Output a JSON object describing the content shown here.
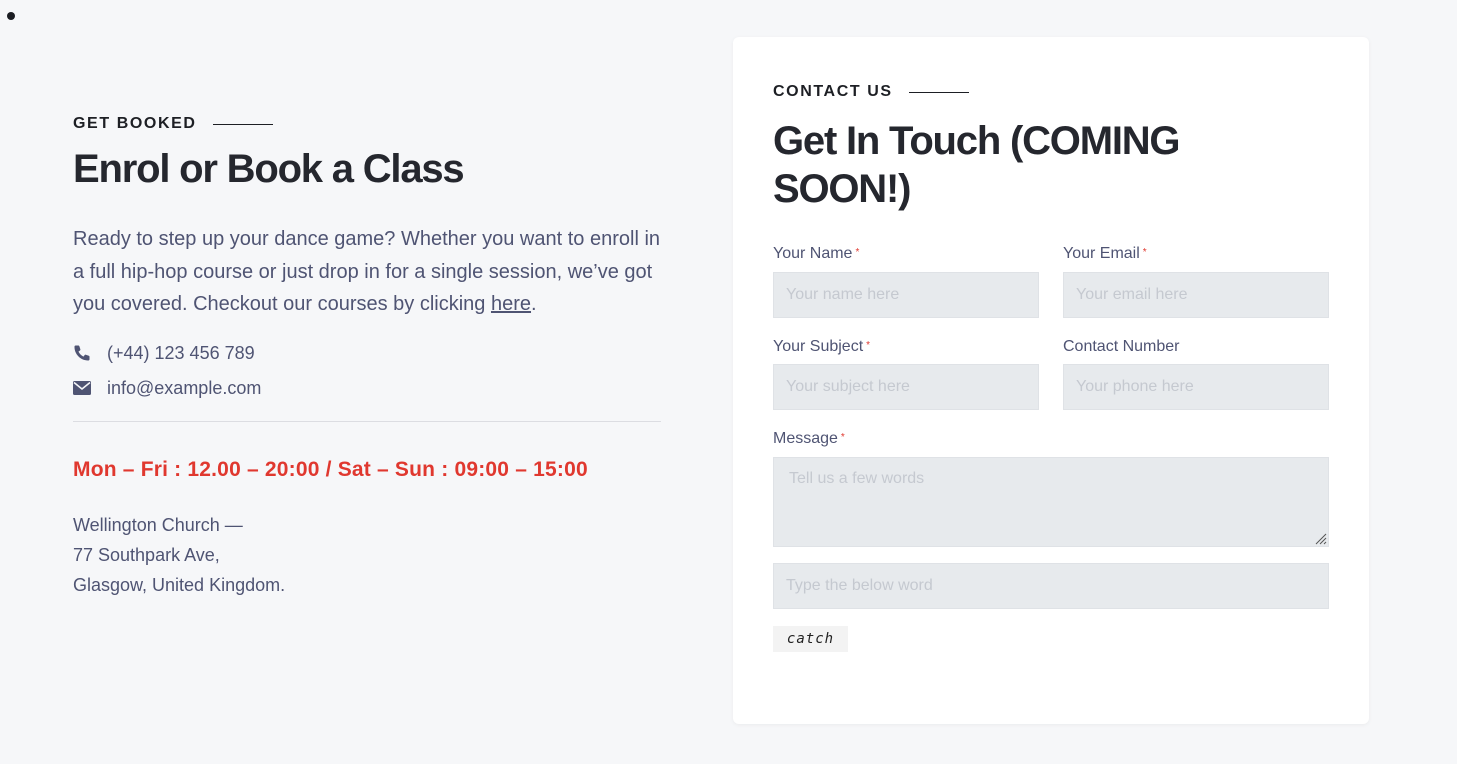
{
  "left": {
    "eyebrow": "GET BOOKED",
    "heading": "Enrol or Book a Class",
    "intro_text": "Ready to step up your dance game? Whether you want to enroll in a full hip-hop course or just drop in for a single session, we’ve got you covered. Checkout our courses by clicking ",
    "intro_link": "here",
    "intro_end": ".",
    "phone": "(+44) 123 456 789",
    "email": "info@example.com",
    "hours": "Mon – Fri : 12.00 – 20:00 / Sat – Sun : 09:00 – 15:00",
    "address_line1": "Wellington Church —",
    "address_line2": "77 Southpark Ave,",
    "address_line3": "Glasgow, United Kingdom."
  },
  "form": {
    "eyebrow": "CONTACT US",
    "heading": "Get In Touch (COMING SOON!)",
    "required_mark": "*",
    "name_label": "Your Name",
    "name_placeholder": "Your name here",
    "email_label": "Your Email",
    "email_placeholder": "Your email here",
    "subject_label": "Your Subject",
    "subject_placeholder": "Your subject here",
    "phone_label": "Contact Number",
    "phone_placeholder": "Your phone here",
    "message_label": "Message",
    "message_placeholder": "Tell us a few words",
    "captcha_placeholder": "Type the below word",
    "captcha_word": "catch"
  },
  "icons": {
    "phone": "phone-icon",
    "email": "envelope-icon"
  },
  "colors": {
    "accent_red": "#e0382f",
    "heading": "#25272e",
    "body_text": "#4f5473",
    "input_bg": "#e7eaed"
  }
}
